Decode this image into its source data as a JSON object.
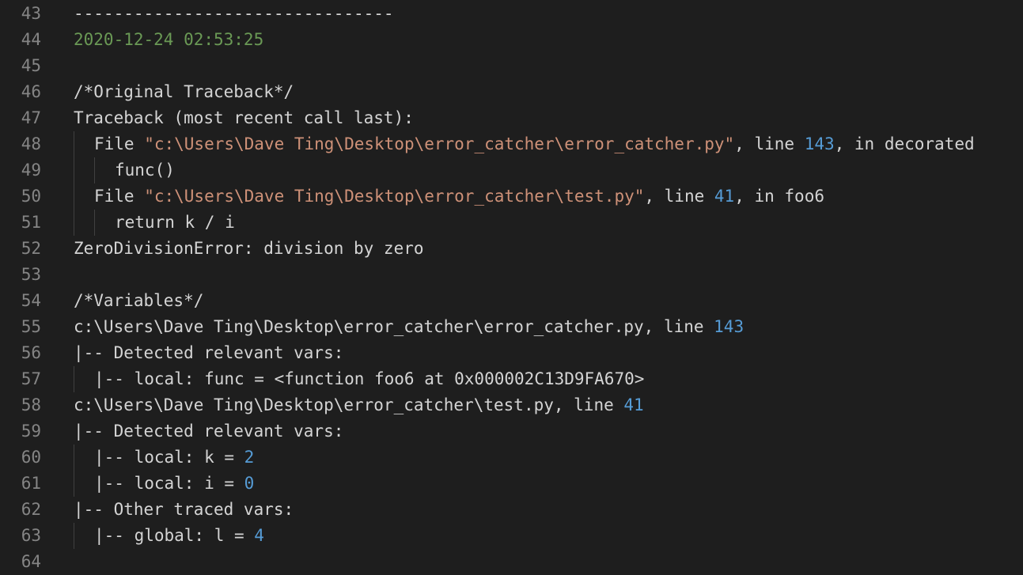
{
  "editor": {
    "lines": [
      {
        "num": "43",
        "indent": 0,
        "segs": [
          {
            "t": "--------------------------------",
            "c": ""
          }
        ]
      },
      {
        "num": "44",
        "indent": 0,
        "segs": [
          {
            "t": "2020-12-24 02:53:25",
            "c": "green"
          }
        ]
      },
      {
        "num": "45",
        "indent": 0,
        "segs": []
      },
      {
        "num": "46",
        "indent": 0,
        "segs": [
          {
            "t": "/*Original Traceback*/",
            "c": ""
          }
        ]
      },
      {
        "num": "47",
        "indent": 0,
        "segs": [
          {
            "t": "Traceback (most recent call last):",
            "c": ""
          }
        ]
      },
      {
        "num": "48",
        "indent": 1,
        "segs": [
          {
            "t": "File ",
            "c": ""
          },
          {
            "t": "\"c:\\Users\\Dave Ting\\Desktop\\error_catcher\\error_catcher.py\"",
            "c": "str"
          },
          {
            "t": ", line ",
            "c": ""
          },
          {
            "t": "143",
            "c": "num"
          },
          {
            "t": ", in decorated",
            "c": ""
          }
        ]
      },
      {
        "num": "49",
        "indent": 2,
        "segs": [
          {
            "t": "func()",
            "c": ""
          }
        ]
      },
      {
        "num": "50",
        "indent": 1,
        "segs": [
          {
            "t": "File ",
            "c": ""
          },
          {
            "t": "\"c:\\Users\\Dave Ting\\Desktop\\error_catcher\\test.py\"",
            "c": "str"
          },
          {
            "t": ", line ",
            "c": ""
          },
          {
            "t": "41",
            "c": "num"
          },
          {
            "t": ", in foo6",
            "c": ""
          }
        ]
      },
      {
        "num": "51",
        "indent": 2,
        "segs": [
          {
            "t": "return k / i",
            "c": ""
          }
        ]
      },
      {
        "num": "52",
        "indent": 0,
        "segs": [
          {
            "t": "ZeroDivisionError: division by zero",
            "c": ""
          }
        ]
      },
      {
        "num": "53",
        "indent": 0,
        "segs": []
      },
      {
        "num": "54",
        "indent": 0,
        "segs": [
          {
            "t": "/*Variables*/",
            "c": ""
          }
        ]
      },
      {
        "num": "55",
        "indent": 0,
        "segs": [
          {
            "t": "c:\\Users\\Dave Ting\\Desktop\\error_catcher\\error_catcher.py, line ",
            "c": ""
          },
          {
            "t": "143",
            "c": "num"
          }
        ]
      },
      {
        "num": "56",
        "indent": 0,
        "segs": [
          {
            "t": "|-- Detected relevant vars:",
            "c": ""
          }
        ]
      },
      {
        "num": "57",
        "indent": 1,
        "segs": [
          {
            "t": "|-- local: func = <function foo6 at 0x000002C13D9FA670>",
            "c": ""
          }
        ]
      },
      {
        "num": "58",
        "indent": 0,
        "segs": [
          {
            "t": "c:\\Users\\Dave Ting\\Desktop\\error_catcher\\test.py, line ",
            "c": ""
          },
          {
            "t": "41",
            "c": "num"
          }
        ]
      },
      {
        "num": "59",
        "indent": 0,
        "segs": [
          {
            "t": "|-- Detected relevant vars:",
            "c": ""
          }
        ]
      },
      {
        "num": "60",
        "indent": 1,
        "segs": [
          {
            "t": "|-- local: k = ",
            "c": ""
          },
          {
            "t": "2",
            "c": "num"
          }
        ]
      },
      {
        "num": "61",
        "indent": 1,
        "segs": [
          {
            "t": "|-- local: i = ",
            "c": ""
          },
          {
            "t": "0",
            "c": "num"
          }
        ]
      },
      {
        "num": "62",
        "indent": 0,
        "segs": [
          {
            "t": "|-- Other traced vars:",
            "c": ""
          }
        ]
      },
      {
        "num": "63",
        "indent": 1,
        "segs": [
          {
            "t": "|-- global: l = ",
            "c": ""
          },
          {
            "t": "4",
            "c": "num"
          }
        ]
      },
      {
        "num": "64",
        "indent": 0,
        "segs": []
      }
    ]
  }
}
